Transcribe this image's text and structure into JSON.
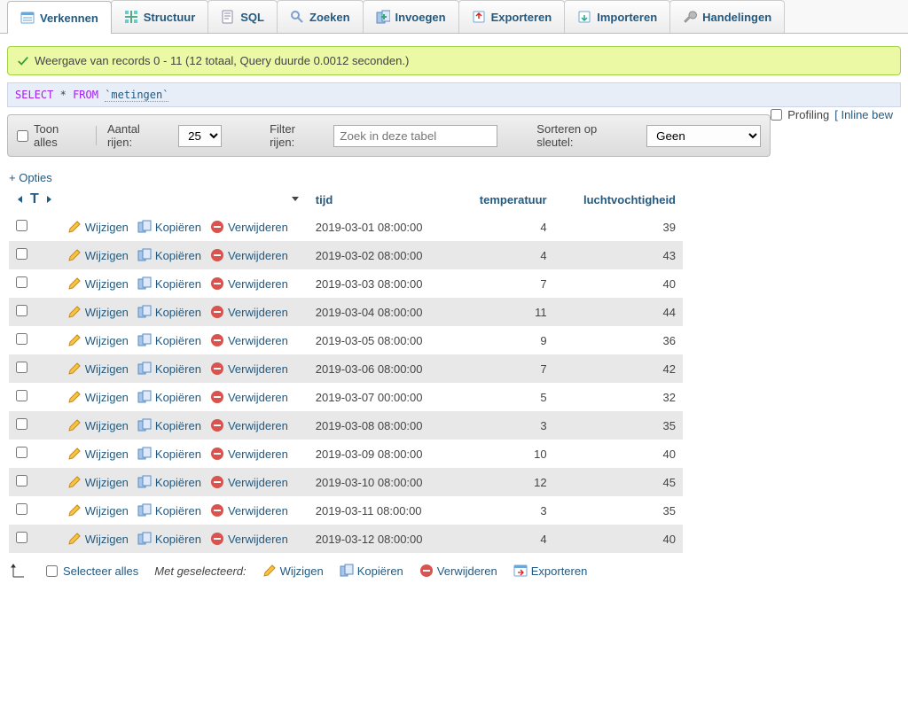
{
  "tabs": [
    {
      "label": "Verkennen",
      "active": true
    },
    {
      "label": "Structuur"
    },
    {
      "label": "SQL"
    },
    {
      "label": "Zoeken"
    },
    {
      "label": "Invoegen"
    },
    {
      "label": "Exporteren"
    },
    {
      "label": "Importeren"
    },
    {
      "label": "Handelingen"
    }
  ],
  "notice": "Weergave van records 0 - 11 (12 totaal, Query duurde 0.0012 seconden.)",
  "sql": {
    "kw1": "SELECT",
    "star": "*",
    "kw2": "FROM",
    "table": "`metingen`"
  },
  "profiling_label": "Profiling",
  "inline_label": "[ Inline bew",
  "toolbar": {
    "show_all": "Toon alles",
    "rowcount_label": "Aantal rijen:",
    "rowcount_value": "25",
    "filter_label": "Filter rijen:",
    "filter_placeholder": "Zoek in deze tabel",
    "sortkey_label": "Sorteren op sleutel:",
    "sortkey_value": "Geen"
  },
  "opties": "+ Opties",
  "columns": {
    "tijd": "tijd",
    "temperatuur": "temperatuur",
    "luchtvochtigheid": "luchtvochtigheid"
  },
  "row_actions": {
    "edit": "Wijzigen",
    "copy": "Kopiëren",
    "delete": "Verwijderen"
  },
  "rows": [
    {
      "tijd": "2019-03-01 08:00:00",
      "temperatuur": "4",
      "luchtvochtigheid": "39"
    },
    {
      "tijd": "2019-03-02 08:00:00",
      "temperatuur": "4",
      "luchtvochtigheid": "43"
    },
    {
      "tijd": "2019-03-03 08:00:00",
      "temperatuur": "7",
      "luchtvochtigheid": "40"
    },
    {
      "tijd": "2019-03-04 08:00:00",
      "temperatuur": "11",
      "luchtvochtigheid": "44"
    },
    {
      "tijd": "2019-03-05 08:00:00",
      "temperatuur": "9",
      "luchtvochtigheid": "36"
    },
    {
      "tijd": "2019-03-06 08:00:00",
      "temperatuur": "7",
      "luchtvochtigheid": "42"
    },
    {
      "tijd": "2019-03-07 00:00:00",
      "temperatuur": "5",
      "luchtvochtigheid": "32"
    },
    {
      "tijd": "2019-03-08 08:00:00",
      "temperatuur": "3",
      "luchtvochtigheid": "35"
    },
    {
      "tijd": "2019-03-09 08:00:00",
      "temperatuur": "10",
      "luchtvochtigheid": "40"
    },
    {
      "tijd": "2019-03-10 08:00:00",
      "temperatuur": "12",
      "luchtvochtigheid": "45"
    },
    {
      "tijd": "2019-03-11 08:00:00",
      "temperatuur": "3",
      "luchtvochtigheid": "35"
    },
    {
      "tijd": "2019-03-12 08:00:00",
      "temperatuur": "4",
      "luchtvochtigheid": "40"
    }
  ],
  "bulk": {
    "select_all": "Selecteer alles",
    "with_selected": "Met geselecteerd:",
    "edit": "Wijzigen",
    "copy": "Kopiëren",
    "delete": "Verwijderen",
    "export": "Exporteren"
  }
}
